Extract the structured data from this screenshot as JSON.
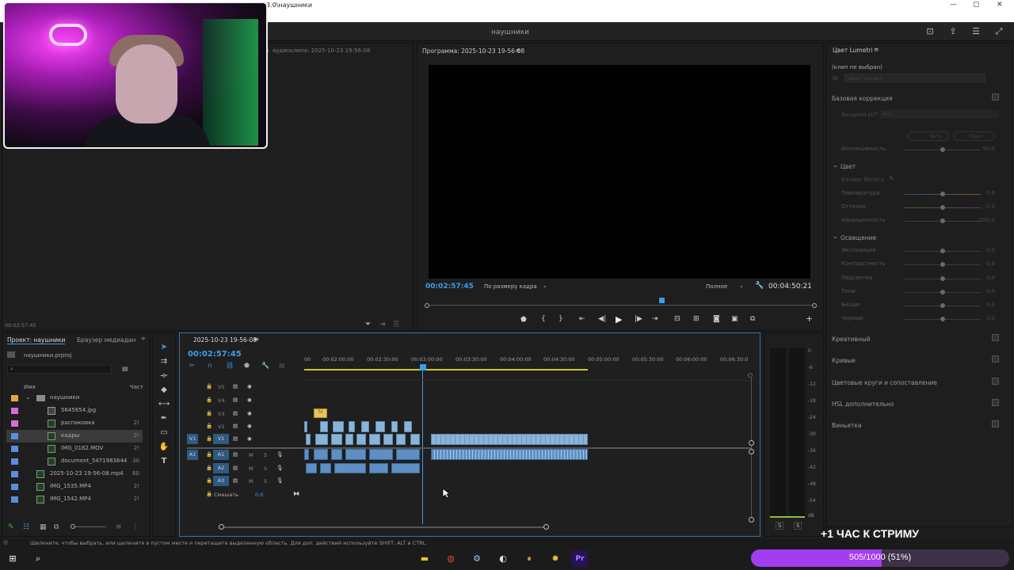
{
  "window": {
    "title": "3.0\\наушники",
    "minimize": "—",
    "maximize": "▢",
    "close": "✕"
  },
  "appbar": {
    "project_name": "наушники"
  },
  "source_monitor": {
    "header": "ш. аудиоклипа: 2025-10-23 19-56-08",
    "timecode": "00:02:57:45"
  },
  "program_monitor": {
    "header": "Программа: 2025-10-23 19-56-08",
    "menu": "≡",
    "timecode_current": "00:02:57:45",
    "fit_label": "По размеру кадра",
    "quality_label": "Полное",
    "timecode_total": "00:04:50:21"
  },
  "lumetri": {
    "title": "Цвет Lumetri",
    "menu": "≡",
    "clip_status": "(клип не выбран)",
    "fx_label": "fx",
    "fx_select": "Цвет Lumetri",
    "basic_correction": "Базовая коррекция",
    "input_lut_label": "Входная LUT",
    "input_lut_value": "Нет",
    "auto_btn": "Авто",
    "reset_btn": "Сброс",
    "intensity_label": "Интенсивность",
    "intensity_value": "50,0",
    "color_section": "Цвет",
    "white_balance": "Баланс белого",
    "temperature_label": "Температура",
    "temperature_value": "0,0",
    "tint_label": "Оттенок",
    "tint_value": "0,0",
    "saturation_label": "Насыщенность",
    "saturation_value": "100,0",
    "light_section": "Освещение",
    "exposure_label": "Экспозиция",
    "exposure_value": "0,0",
    "contrast_label": "Контрастность",
    "contrast_value": "0,0",
    "highlights_label": "Подсветка",
    "highlights_value": "0,0",
    "shadows_label": "Тени",
    "shadows_value": "0,0",
    "whites_label": "Белые",
    "whites_value": "0,0",
    "blacks_label": "Черные",
    "blacks_value": "0,0",
    "sections": [
      "Креативный",
      "Кривые",
      "Цветовые круги и сопоставление",
      "HSL дополнительно",
      "Виньетка"
    ]
  },
  "project_panel": {
    "tab_project": "Проект: наушники",
    "tab_browser": "Браузер медиадан",
    "tab_more": "»",
    "file": "наушники.prproj",
    "col_name": "Имя",
    "col_rate": "Част",
    "items": [
      {
        "name": "наушники",
        "rate": "",
        "color": "#e7a53a",
        "kind": "folder"
      },
      {
        "name": "5645654.jpg",
        "rate": "",
        "color": "#d86ad8",
        "kind": "image"
      },
      {
        "name": "распаковка",
        "rate": "2!",
        "color": "#d86ad8",
        "kind": "seq"
      },
      {
        "name": "кадры",
        "rate": "2!",
        "color": "#5a8de0",
        "kind": "seq"
      },
      {
        "name": "IMG_0182.MOV",
        "rate": "2!",
        "color": "#5a8de0",
        "kind": "seq"
      },
      {
        "name": "document_5471983644",
        "rate": "30",
        "color": "#5a8de0",
        "kind": "seq"
      },
      {
        "name": "2025-10-23 19-56-08.mp4",
        "rate": "60",
        "color": "#5a8de0",
        "kind": "seq"
      },
      {
        "name": "IMG_1535.MP4",
        "rate": "2!",
        "color": "#5a8de0",
        "kind": "seq"
      },
      {
        "name": "IMG_1542.MP4",
        "rate": "2!",
        "color": "#5a8de0",
        "kind": "seq"
      }
    ]
  },
  "timeline": {
    "tab": "2025-10-23 19-56-08",
    "menu": "≡",
    "timecode": "00:02:57:45",
    "ruler": [
      "00",
      "00:02:00:00",
      "00:02:30:00",
      "00:03:00:00",
      "00:03:30:00",
      "00:04:00:00",
      "00:04:30:00",
      "00:05:00:00",
      "00:05:30:00",
      "00:06:00:00",
      "00:06:30:0"
    ],
    "video_tracks": [
      "V5",
      "V4",
      "V3",
      "V2",
      "V1"
    ],
    "audio_tracks": [
      "A1",
      "A2",
      "A3"
    ],
    "source_v": "V1",
    "source_a": "A1",
    "mix_label": "Смешать",
    "mix_value": "0,0",
    "m": "M",
    "s": "S"
  },
  "meter": {
    "scale": [
      "0",
      "-6",
      "-12",
      "-18",
      "-24",
      "-30",
      "-36",
      "-42",
      "-48",
      "-54",
      "dB"
    ],
    "solo_left": "S",
    "solo_right": "S"
  },
  "status_bar": {
    "text": "Щелкните, чтобы выбрать, или щелкните в пустом месте и перетащите выделенную область. Для доп. действий используйте SHIFT, ALT и CTRL."
  },
  "stream_overlay": {
    "caption": "+1 ЧАС К СТРИМУ",
    "progress_text": "505/1000 (51%)",
    "progress_fraction": 0.505,
    "accent": "#a43cf0"
  }
}
